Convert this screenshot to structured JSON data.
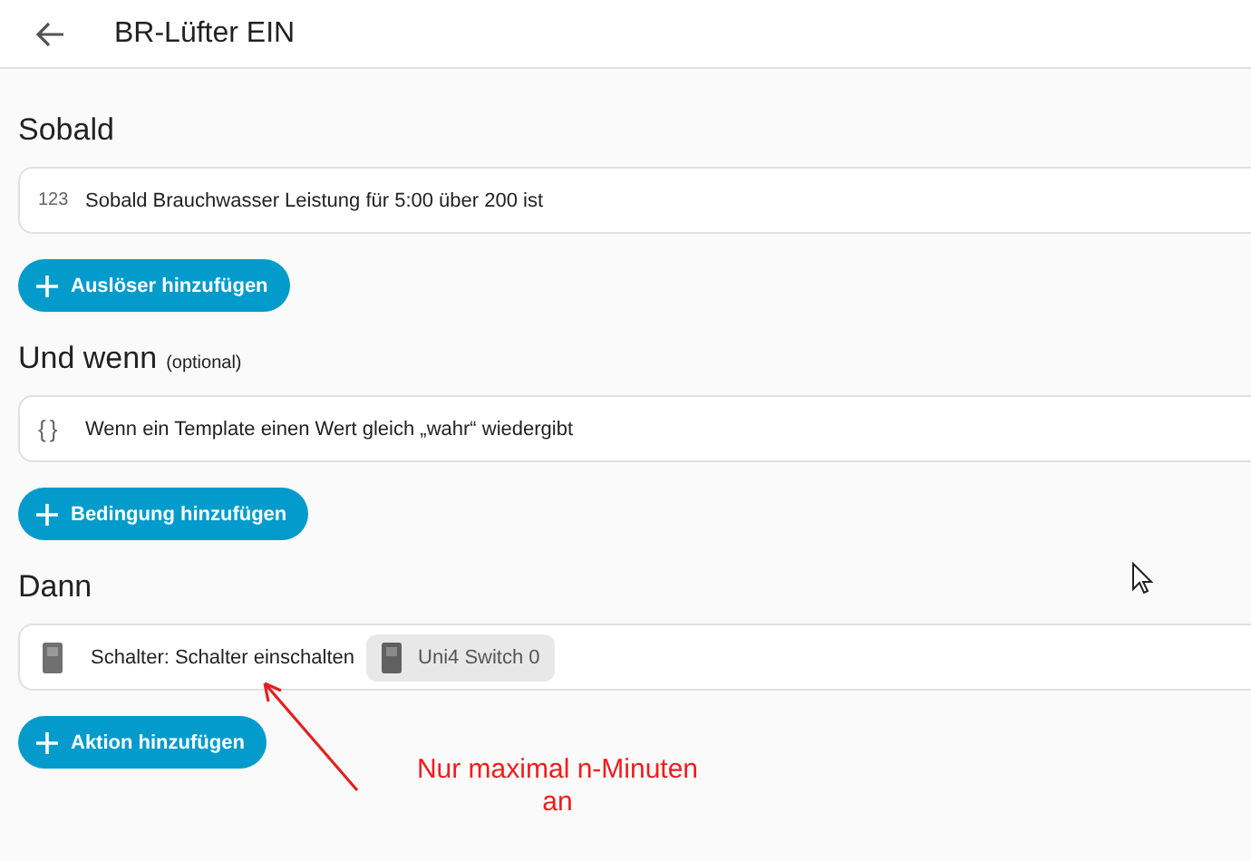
{
  "header": {
    "title": "BR-Lüfter EIN"
  },
  "sections": [
    {
      "title": "Sobald",
      "card": {
        "kind": "number",
        "icon_text": "123",
        "text": "Sobald Brauchwasser Leistung für 5:00 über 200 ist"
      },
      "button": "Auslöser hinzufügen"
    },
    {
      "title": "Und wenn",
      "note": "(optional)",
      "card": {
        "kind": "template",
        "icon_text": "{}",
        "text": "Wenn ein Template einen Wert gleich „wahr“ wiedergibt"
      },
      "button": "Bedingung hinzufügen"
    },
    {
      "title": "Dann",
      "card": {
        "kind": "switch",
        "text": "Schalter: Schalter einschalten",
        "chip": "Uni4 Switch 0"
      },
      "button": "Aktion hinzufügen"
    }
  ],
  "annotation": {
    "lines": [
      "Nur maximal n-Minuten",
      "an"
    ]
  }
}
